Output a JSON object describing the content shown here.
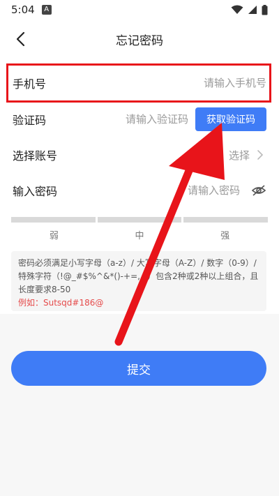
{
  "status": {
    "time": "5:04",
    "notification": "A"
  },
  "header": {
    "title": "忘记密码"
  },
  "form": {
    "phone": {
      "label": "手机号",
      "placeholder": "请输入手机号"
    },
    "code": {
      "label": "验证码",
      "placeholder": "请输入验证码",
      "button": "获取验证码"
    },
    "account": {
      "label": "选择账号",
      "value": "选择"
    },
    "password": {
      "label": "输入密码",
      "placeholder": "请输入密码"
    }
  },
  "strength": {
    "levels": [
      "弱",
      "中",
      "强"
    ]
  },
  "hint": {
    "text": "密码必须满足小写字母（a-z）/ 大写字母（A-Z）/ 数字（0-9）/ 特殊字符（!@_#$%^&*()-+=,.?）包含2种或2种以上组合，且长度要求8-50",
    "example": "例如：Sutsqd#186@"
  },
  "submit": {
    "label": "提交"
  },
  "colors": {
    "primary": "#3f7cf6",
    "highlight": "#e8141a",
    "example": "#e54b4b"
  }
}
